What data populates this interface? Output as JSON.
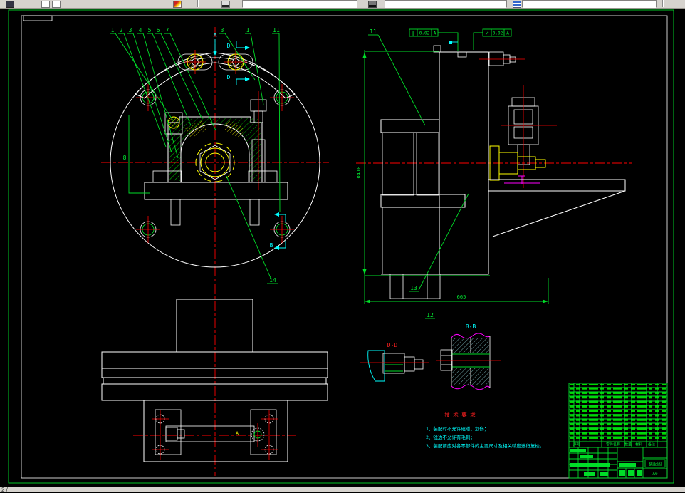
{
  "statusbar": {
    "text": "2 /"
  },
  "drawing": {
    "balloons": {
      "left": [
        "1",
        "2",
        "3",
        "4",
        "5",
        "6",
        "7"
      ],
      "right": [
        "3",
        "1",
        "11"
      ],
      "side": "8",
      "center": "14",
      "section_top": "11",
      "section_mid": "13",
      "section_low": "12"
    },
    "views": {
      "arrow_a": "A",
      "cut_d": "D",
      "cut_b": "B",
      "detail_dd": "D-D",
      "detail_bb": "B-B",
      "datum_a": "A"
    },
    "gdt": {
      "f1": {
        "sym": "∥",
        "tol": "0.02",
        "datum": "A"
      },
      "f2": {
        "sym": "↗",
        "tol": "0.02",
        "datum": "A"
      }
    },
    "dims": {
      "overall": "665",
      "dia": "Φ410"
    },
    "tech": {
      "title": "技 术 要 求",
      "item1": "1、装配时不允许磕碰、划伤；",
      "item2": "2、锐边不允许有毛刺；",
      "item3": "3、装配前应对各零部件的主要尺寸及相关精度进行复检。"
    },
    "titleblock": {
      "name": "装配图",
      "size": "A0",
      "headers": [
        "序号",
        "零件名称",
        "数量",
        "材料",
        "备注"
      ]
    }
  }
}
